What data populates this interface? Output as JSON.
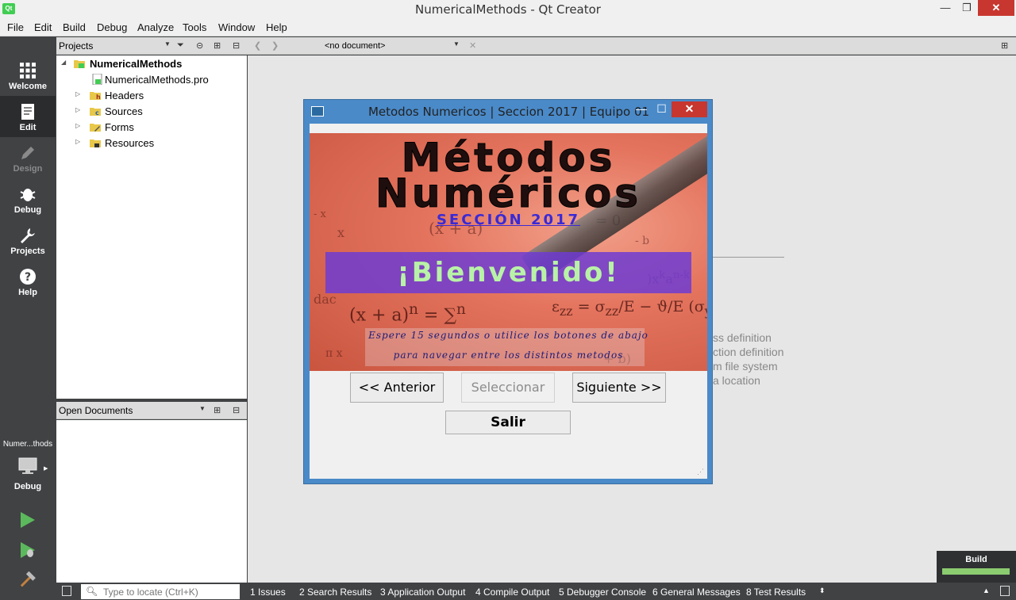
{
  "window": {
    "title": "NumericalMethods - Qt Creator"
  },
  "menu": [
    "File",
    "Edit",
    "Build",
    "Debug",
    "Analyze",
    "Tools",
    "Window",
    "Help"
  ],
  "modes": [
    {
      "label": "Welcome",
      "icon": "grid-icon"
    },
    {
      "label": "Edit",
      "icon": "document-icon"
    },
    {
      "label": "Design",
      "icon": "pencil-icon"
    },
    {
      "label": "Debug",
      "icon": "bug-icon"
    },
    {
      "label": "Projects",
      "icon": "wrench-icon"
    },
    {
      "label": "Help",
      "icon": "question-icon"
    }
  ],
  "kit": {
    "name": "Numer...thods",
    "build_mode": "Debug"
  },
  "projects": {
    "header": "Projects",
    "root": "NumericalMethods",
    "items": [
      "NumericalMethods.pro",
      "Headers",
      "Sources",
      "Forms",
      "Resources"
    ]
  },
  "open_documents": {
    "header": "Open Documents"
  },
  "editor": {
    "document_selector": "<no document>",
    "hints": [
      "ss definition",
      "ction definition",
      "m file system",
      "a location"
    ]
  },
  "build": {
    "label": "Build",
    "progress": 1.0
  },
  "locator": {
    "placeholder": "Type to locate (Ctrl+K)"
  },
  "output_tabs": [
    "1  Issues",
    "2  Search Results",
    "3  Application Output",
    "4  Compile Output",
    "5  Debugger Console",
    "6  General Messages",
    "8  Test Results"
  ],
  "dialog": {
    "title": "Metodos Numericos | Seccion 2017 | Equipo 01",
    "heading_line1": "Métodos",
    "heading_line2": "Numéricos",
    "section": "SECCIÓN 2017",
    "welcome": "¡Bienvenido!",
    "instruction_line1": "Espere 15 segundos o utilice los botones de abajo",
    "instruction_line2": "para navegar entre los distintos metodos",
    "btn_prev": "<< Anterior",
    "btn_select": "Seleccionar",
    "btn_next": "Siguiente >>",
    "btn_exit": "Salir"
  },
  "colors": {
    "accent": "#41cd52",
    "dialog_frame": "#4a8ac9",
    "close_button": "#c7372f",
    "welcome_band": "#6e3cd2",
    "build_progress": "#8ccc70"
  }
}
